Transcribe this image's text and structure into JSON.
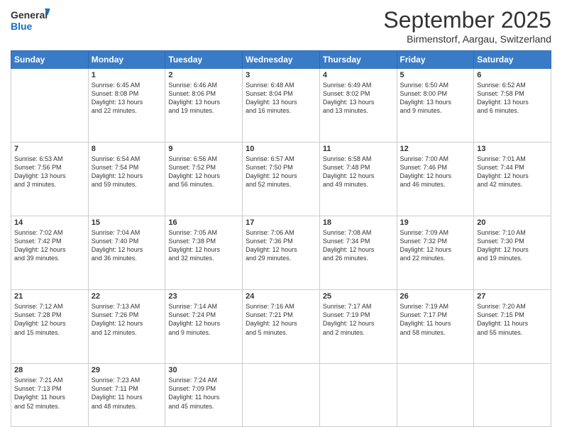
{
  "header": {
    "logo_general": "General",
    "logo_blue": "Blue",
    "month_title": "September 2025",
    "location": "Birmenstorf, Aargau, Switzerland"
  },
  "weekdays": [
    "Sunday",
    "Monday",
    "Tuesday",
    "Wednesday",
    "Thursday",
    "Friday",
    "Saturday"
  ],
  "weeks": [
    [
      {
        "day": "",
        "info": ""
      },
      {
        "day": "1",
        "info": "Sunrise: 6:45 AM\nSunset: 8:08 PM\nDaylight: 13 hours\nand 22 minutes."
      },
      {
        "day": "2",
        "info": "Sunrise: 6:46 AM\nSunset: 8:06 PM\nDaylight: 13 hours\nand 19 minutes."
      },
      {
        "day": "3",
        "info": "Sunrise: 6:48 AM\nSunset: 8:04 PM\nDaylight: 13 hours\nand 16 minutes."
      },
      {
        "day": "4",
        "info": "Sunrise: 6:49 AM\nSunset: 8:02 PM\nDaylight: 13 hours\nand 13 minutes."
      },
      {
        "day": "5",
        "info": "Sunrise: 6:50 AM\nSunset: 8:00 PM\nDaylight: 13 hours\nand 9 minutes."
      },
      {
        "day": "6",
        "info": "Sunrise: 6:52 AM\nSunset: 7:58 PM\nDaylight: 13 hours\nand 6 minutes."
      }
    ],
    [
      {
        "day": "7",
        "info": "Sunrise: 6:53 AM\nSunset: 7:56 PM\nDaylight: 13 hours\nand 3 minutes."
      },
      {
        "day": "8",
        "info": "Sunrise: 6:54 AM\nSunset: 7:54 PM\nDaylight: 12 hours\nand 59 minutes."
      },
      {
        "day": "9",
        "info": "Sunrise: 6:56 AM\nSunset: 7:52 PM\nDaylight: 12 hours\nand 56 minutes."
      },
      {
        "day": "10",
        "info": "Sunrise: 6:57 AM\nSunset: 7:50 PM\nDaylight: 12 hours\nand 52 minutes."
      },
      {
        "day": "11",
        "info": "Sunrise: 6:58 AM\nSunset: 7:48 PM\nDaylight: 12 hours\nand 49 minutes."
      },
      {
        "day": "12",
        "info": "Sunrise: 7:00 AM\nSunset: 7:46 PM\nDaylight: 12 hours\nand 46 minutes."
      },
      {
        "day": "13",
        "info": "Sunrise: 7:01 AM\nSunset: 7:44 PM\nDaylight: 12 hours\nand 42 minutes."
      }
    ],
    [
      {
        "day": "14",
        "info": "Sunrise: 7:02 AM\nSunset: 7:42 PM\nDaylight: 12 hours\nand 39 minutes."
      },
      {
        "day": "15",
        "info": "Sunrise: 7:04 AM\nSunset: 7:40 PM\nDaylight: 12 hours\nand 36 minutes."
      },
      {
        "day": "16",
        "info": "Sunrise: 7:05 AM\nSunset: 7:38 PM\nDaylight: 12 hours\nand 32 minutes."
      },
      {
        "day": "17",
        "info": "Sunrise: 7:06 AM\nSunset: 7:36 PM\nDaylight: 12 hours\nand 29 minutes."
      },
      {
        "day": "18",
        "info": "Sunrise: 7:08 AM\nSunset: 7:34 PM\nDaylight: 12 hours\nand 26 minutes."
      },
      {
        "day": "19",
        "info": "Sunrise: 7:09 AM\nSunset: 7:32 PM\nDaylight: 12 hours\nand 22 minutes."
      },
      {
        "day": "20",
        "info": "Sunrise: 7:10 AM\nSunset: 7:30 PM\nDaylight: 12 hours\nand 19 minutes."
      }
    ],
    [
      {
        "day": "21",
        "info": "Sunrise: 7:12 AM\nSunset: 7:28 PM\nDaylight: 12 hours\nand 15 minutes."
      },
      {
        "day": "22",
        "info": "Sunrise: 7:13 AM\nSunset: 7:26 PM\nDaylight: 12 hours\nand 12 minutes."
      },
      {
        "day": "23",
        "info": "Sunrise: 7:14 AM\nSunset: 7:24 PM\nDaylight: 12 hours\nand 9 minutes."
      },
      {
        "day": "24",
        "info": "Sunrise: 7:16 AM\nSunset: 7:21 PM\nDaylight: 12 hours\nand 5 minutes."
      },
      {
        "day": "25",
        "info": "Sunrise: 7:17 AM\nSunset: 7:19 PM\nDaylight: 12 hours\nand 2 minutes."
      },
      {
        "day": "26",
        "info": "Sunrise: 7:19 AM\nSunset: 7:17 PM\nDaylight: 11 hours\nand 58 minutes."
      },
      {
        "day": "27",
        "info": "Sunrise: 7:20 AM\nSunset: 7:15 PM\nDaylight: 11 hours\nand 55 minutes."
      }
    ],
    [
      {
        "day": "28",
        "info": "Sunrise: 7:21 AM\nSunset: 7:13 PM\nDaylight: 11 hours\nand 52 minutes."
      },
      {
        "day": "29",
        "info": "Sunrise: 7:23 AM\nSunset: 7:11 PM\nDaylight: 11 hours\nand 48 minutes."
      },
      {
        "day": "30",
        "info": "Sunrise: 7:24 AM\nSunset: 7:09 PM\nDaylight: 11 hours\nand 45 minutes."
      },
      {
        "day": "",
        "info": ""
      },
      {
        "day": "",
        "info": ""
      },
      {
        "day": "",
        "info": ""
      },
      {
        "day": "",
        "info": ""
      }
    ]
  ]
}
